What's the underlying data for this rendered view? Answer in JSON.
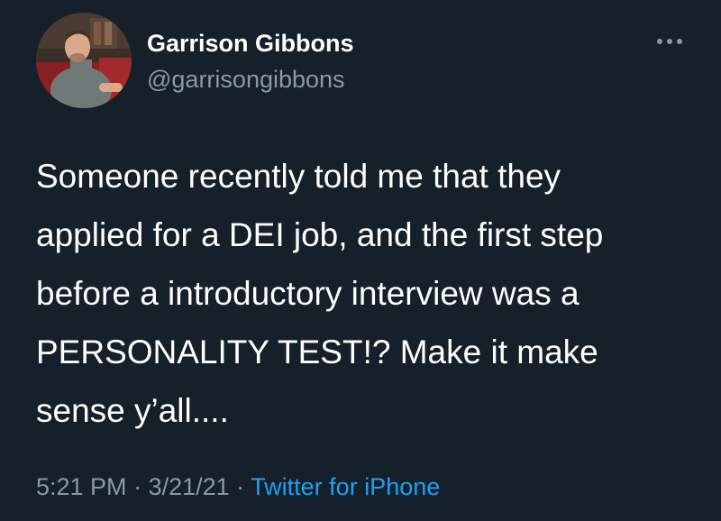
{
  "author": {
    "display_name": "Garrison Gibbons",
    "handle": "@garrisongibbons"
  },
  "tweet": {
    "lines": [
      "Someone recently told me that they",
      "applied for a DEI job, and the first step",
      "before a introductory interview was a",
      "PERSONALITY TEST!? Make it make",
      "sense y’all...."
    ]
  },
  "meta": {
    "time": "5:21 PM",
    "separator": " · ",
    "date": "3/21/21",
    "source": "Twitter for iPhone"
  },
  "icons": {
    "more": "more-horizontal-icon",
    "avatar": "profile-photo"
  },
  "colors": {
    "background": "#15202b",
    "secondary_text": "#8899a6",
    "link": "#1da1f2"
  }
}
